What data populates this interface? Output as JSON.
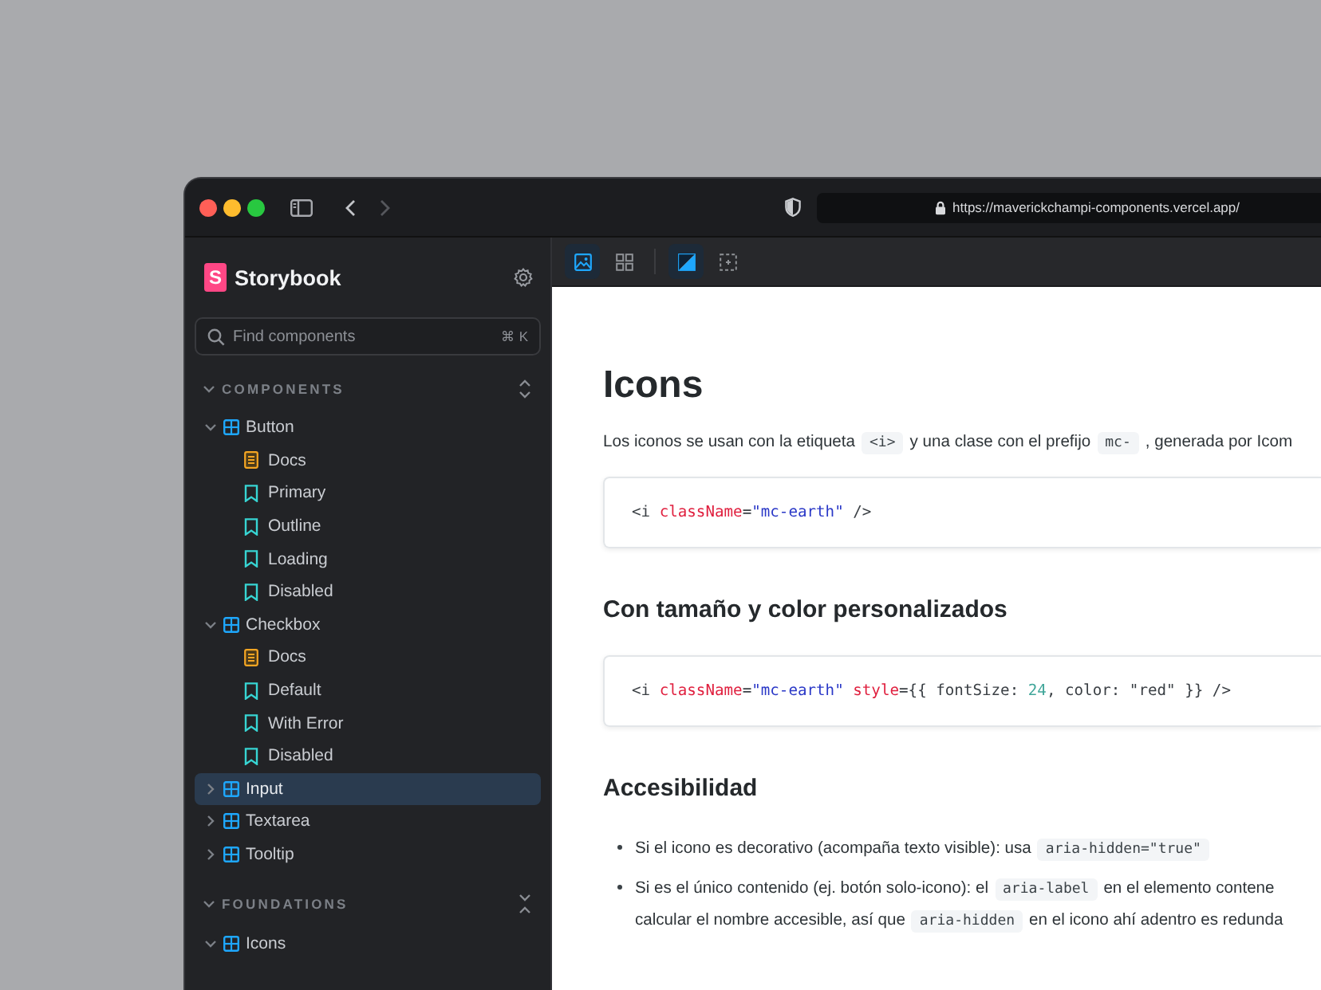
{
  "browser": {
    "url": "https://maverickchampi-components.vercel.app/",
    "back_enabled": true,
    "forward_enabled": false
  },
  "sidebar": {
    "logo_mark": "S",
    "title": "Storybook",
    "search": {
      "placeholder": "Find components",
      "shortcut": "⌘ K"
    },
    "sections": [
      {
        "label": "COMPONENTS",
        "expanded": true,
        "all_expanded": false,
        "items": [
          {
            "label": "Button",
            "expanded": true,
            "selected": false,
            "children": [
              {
                "label": "Docs",
                "kind": "docs",
                "selected": false
              },
              {
                "label": "Primary",
                "kind": "story",
                "selected": false
              },
              {
                "label": "Outline",
                "kind": "story",
                "selected": false
              },
              {
                "label": "Loading",
                "kind": "story",
                "selected": false
              },
              {
                "label": "Disabled",
                "kind": "story",
                "selected": false
              }
            ]
          },
          {
            "label": "Checkbox",
            "expanded": true,
            "selected": false,
            "children": [
              {
                "label": "Docs",
                "kind": "docs",
                "selected": false
              },
              {
                "label": "Default",
                "kind": "story",
                "selected": false
              },
              {
                "label": "With Error",
                "kind": "story",
                "selected": false
              },
              {
                "label": "Disabled",
                "kind": "story",
                "selected": false
              }
            ]
          },
          {
            "label": "Input",
            "expanded": false,
            "selected": true
          },
          {
            "label": "Textarea",
            "expanded": false,
            "selected": false
          },
          {
            "label": "Tooltip",
            "expanded": false,
            "selected": false
          }
        ]
      },
      {
        "label": "FOUNDATIONS",
        "expanded": true,
        "all_expanded": true,
        "items": [
          {
            "label": "Icons",
            "expanded": true,
            "selected": false
          }
        ]
      }
    ]
  },
  "main": {
    "toolbar": {
      "groups": [
        [
          {
            "kind": "image",
            "selected": true
          },
          {
            "kind": "grid",
            "selected": false
          }
        ],
        [
          {
            "kind": "contrast",
            "selected": true
          },
          {
            "kind": "outline",
            "selected": false
          }
        ]
      ]
    },
    "blocks": [
      {
        "kind": "h1",
        "text": "Icons"
      },
      {
        "kind": "p",
        "segments": [
          {
            "kind": "text",
            "text": "Los iconos se usan con la etiqueta"
          },
          {
            "kind": "code",
            "text": "<i>"
          },
          {
            "kind": "text",
            "text": "y una clase con el prefijo"
          },
          {
            "kind": "code",
            "text": "mc-"
          },
          {
            "kind": "text",
            "text": ", generada por Icom"
          }
        ]
      },
      {
        "kind": "code",
        "tokens": [
          {
            "kind": "plain",
            "text": "<i "
          },
          {
            "kind": "attr",
            "text": "className"
          },
          {
            "kind": "plain",
            "text": "="
          },
          {
            "kind": "string",
            "text": "\"mc-earth\""
          },
          {
            "kind": "plain",
            "text": " />"
          }
        ]
      },
      {
        "kind": "h2",
        "text": "Con tamaño y color personalizados"
      },
      {
        "kind": "code",
        "tokens": [
          {
            "kind": "plain",
            "text": "<i "
          },
          {
            "kind": "attr",
            "text": "className"
          },
          {
            "kind": "plain",
            "text": "="
          },
          {
            "kind": "string",
            "text": "\"mc-earth\""
          },
          {
            "kind": "attr",
            "text": " style"
          },
          {
            "kind": "plain",
            "text": "={{ fontSize: "
          },
          {
            "kind": "number",
            "text": "24"
          },
          {
            "kind": "plain",
            "text": ", color: \"red\" }} />"
          }
        ]
      },
      {
        "kind": "h2",
        "text": "Accesibilidad"
      },
      {
        "kind": "list",
        "items": [
          {
            "lines": [
              [
                {
                  "kind": "text",
                  "text": "Si el icono es decorativo (acompaña texto visible): usa"
                },
                {
                  "kind": "code",
                  "text": "aria-hidden=\"true\""
                }
              ]
            ]
          },
          {
            "lines": [
              [
                {
                  "kind": "text",
                  "text": "Si es el único contenido (ej. botón solo-icono): el"
                },
                {
                  "kind": "code",
                  "text": "aria-label"
                },
                {
                  "kind": "text",
                  "text": "en el elemento contene"
                }
              ],
              [
                {
                  "kind": "text",
                  "text": "calcular el nombre accesible, así que"
                },
                {
                  "kind": "code",
                  "text": "aria-hidden"
                },
                {
                  "kind": "text",
                  "text": "en el icono ahí adentro es redunda"
                }
              ]
            ]
          }
        ]
      }
    ]
  }
}
